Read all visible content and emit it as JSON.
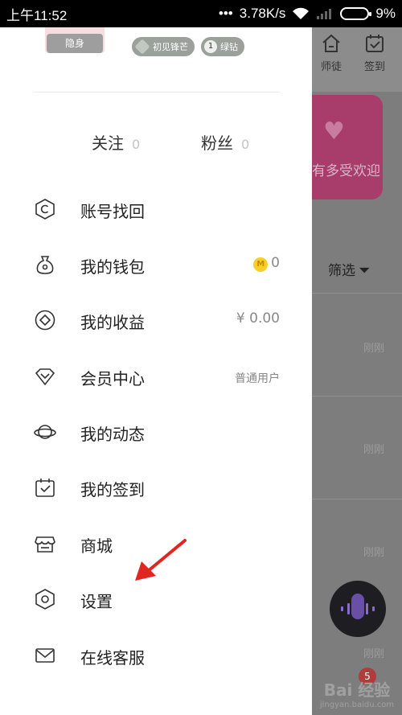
{
  "status_bar": {
    "time": "上午11:52",
    "network_speed": "3.78K/s",
    "battery": "9%",
    "signal_dots": "•••"
  },
  "drawer": {
    "stealth_label": "隐身",
    "badges": [
      {
        "label": "初见锋芒"
      },
      {
        "level": "1",
        "label": "绿钻"
      }
    ],
    "follow": {
      "label": "关注",
      "count": "0"
    },
    "fans": {
      "label": "粉丝",
      "count": "0"
    },
    "menu": [
      {
        "label": "账号找回",
        "icon": "account-recovery-icon",
        "value": ""
      },
      {
        "label": "我的钱包",
        "icon": "wallet-icon",
        "value": "0",
        "value_icon": "coin-icon",
        "coin_letter": "M"
      },
      {
        "label": "我的收益",
        "icon": "earnings-icon",
        "value": "¥ 0.00"
      },
      {
        "label": "会员中心",
        "icon": "diamond-icon",
        "value": "普通用户"
      },
      {
        "label": "我的动态",
        "icon": "planet-icon",
        "value": ""
      },
      {
        "label": "我的签到",
        "icon": "calendar-check-icon",
        "value": ""
      },
      {
        "label": "商城",
        "icon": "store-icon",
        "value": ""
      },
      {
        "label": "设置",
        "icon": "settings-icon",
        "value": ""
      },
      {
        "label": "在线客服",
        "icon": "mail-icon",
        "value": ""
      }
    ]
  },
  "background": {
    "tabs": [
      {
        "label": "师徒",
        "icon": "house-icon"
      },
      {
        "label": "签到",
        "icon": "calendar-icon"
      }
    ],
    "banner_text": "有多受欢迎",
    "filter_label": "筛选",
    "row_times": [
      "刚刚",
      "刚刚",
      "刚刚",
      "刚刚"
    ],
    "notification_count": "5",
    "watermark": "Bai 经验",
    "watermark_sub": "jingyan.baidu.com"
  },
  "colors": {
    "accent_pink": "#a83c6a",
    "coin_yellow": "#f7cf26",
    "arrow_red": "#e0261f"
  }
}
